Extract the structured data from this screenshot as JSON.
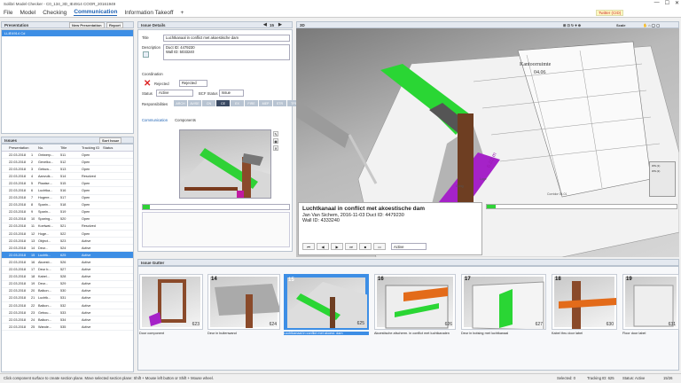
{
  "window": {
    "title": "Solibri Model Checker - C0_134_3D_IE4914 COOR_20161949",
    "minimize": "—",
    "maximize": "☐",
    "close": "✕"
  },
  "menu": {
    "items": [
      "File",
      "Model",
      "Checking",
      "Communication",
      "Information Takeoff",
      "+"
    ]
  },
  "toolbar_right": {
    "twitter": "Twitter (CID)"
  },
  "presentation": {
    "title": "Presentation",
    "new_btn": "New Presentation",
    "report_btn": "Report",
    "items": [
      "LLIE4914 Cd"
    ]
  },
  "issues": {
    "title": "Issues",
    "sort_btn": "Sort Issue",
    "columns": [
      "Presentation",
      "No.",
      "Title",
      "Tracking ID",
      "Status"
    ],
    "rows": [
      [
        "22.03.2018",
        "1",
        "Ontwerp...",
        "511",
        "Open"
      ],
      [
        "22.03.2018",
        "2",
        "Gevelko...",
        "512",
        "Open"
      ],
      [
        "22.03.2018",
        "3",
        "Gebuw...",
        "513",
        "Open"
      ],
      [
        "22.03.2018",
        "4",
        "Aanvulk...",
        "514",
        "Resolved"
      ],
      [
        "22.03.2018",
        "5",
        "Plaatse...",
        "515",
        "Open"
      ],
      [
        "22.03.2018",
        "6",
        "Luchtka...",
        "516",
        "Open"
      ],
      [
        "22.03.2018",
        "7",
        "Hogere...",
        "517",
        "Open"
      ],
      [
        "22.03.2018",
        "8",
        "Sparin...",
        "518",
        "Open"
      ],
      [
        "22.03.2018",
        "9",
        "Sparin...",
        "519",
        "Open"
      ],
      [
        "22.03.2018",
        "10",
        "Sparing...",
        "520",
        "Open"
      ],
      [
        "22.03.2018",
        "11",
        "Koelwat...",
        "521",
        "Resolved"
      ],
      [
        "22.03.2018",
        "12",
        "Hoge...",
        "522",
        "Open"
      ],
      [
        "22.03.2018",
        "13",
        "Object...",
        "523",
        "Active"
      ],
      [
        "22.03.2018",
        "14",
        "Deur...",
        "524",
        "Active"
      ],
      [
        "22.03.2018",
        "15",
        "Luchtk...",
        "625",
        "Active"
      ],
      [
        "22.03.2018",
        "16",
        "Akoesti...",
        "526",
        "Active"
      ],
      [
        "22.03.2018",
        "17",
        "Deur b...",
        "527",
        "Active"
      ],
      [
        "22.03.2018",
        "18",
        "Kabel...",
        "528",
        "Active"
      ],
      [
        "22.03.2018",
        "19",
        "Deur...",
        "529",
        "Active"
      ],
      [
        "22.03.2018",
        "20",
        "Balkon...",
        "530",
        "Active"
      ],
      [
        "22.03.2018",
        "21",
        "Luchtk...",
        "531",
        "Active"
      ],
      [
        "22.03.2018",
        "22",
        "Balkon...",
        "532",
        "Active"
      ],
      [
        "22.03.2018",
        "23",
        "Gebou...",
        "533",
        "Active"
      ],
      [
        "22.03.2018",
        "24",
        "Balkon...",
        "534",
        "Active"
      ],
      [
        "22.03.2018",
        "25",
        "Wande...",
        "535",
        "Active"
      ]
    ],
    "selected_index": 14
  },
  "issue_details": {
    "title": "Issue Details",
    "page": "15",
    "title_label": "Title",
    "title_value": "Luchtkanaal in conflict met akoestische dam",
    "desc_label": "Description",
    "desc_lines": [
      "Duct ID: 4479230",
      "Wall ID: 5033240"
    ],
    "coordination_label": "Coordination",
    "rejected_label": "Rejected",
    "rejected_value": "Rejected",
    "status_label": "Status",
    "status_value": "Active",
    "bcf_label": "BCF Status",
    "bcf_value": "Issue",
    "responsibilities_label": "Responsibilities",
    "responsibilities": [
      "ARCH",
      "AV/SE",
      "CN",
      "CE",
      "EX",
      "FIRE",
      "MEP",
      "STR",
      "TPE"
    ],
    "active_resp": "CE",
    "tabs": [
      "Communication",
      "Components"
    ]
  },
  "view3d": {
    "title": "3D",
    "zoom_label": "Scale",
    "plan_title": "Kantoorruimte",
    "plan_number": "04.06",
    "room_labels": [
      "Loge",
      "Gang",
      "Corridor 04.01"
    ],
    "dimension": "6.02 m",
    "issue_title": "Luchtkanaal in conflict met akoestische dam",
    "issue_meta": "Jan Van Sichem, 2016-11-03 Duct ID: 4479230",
    "issue_wall": "Wall ID: 4333240",
    "status_value": "Active",
    "callout_labels": [
      "WS (1)",
      "WS (2)"
    ]
  },
  "gutter": {
    "title": "Issue Gutter",
    "items": [
      {
        "num": "",
        "count": "623",
        "caption": "Door component"
      },
      {
        "num": "14",
        "count": "624",
        "caption": "Deur in buitenwand"
      },
      {
        "num": "15",
        "count": "625",
        "caption": "Luchtkanaal in conflict met akoest. dam"
      },
      {
        "num": "16",
        "count": "626",
        "caption": "Akoestische afscherm. in conflict met luchtkanalen"
      },
      {
        "num": "17",
        "count": "627",
        "caption": "Deur in botsing met luchtkanaal"
      },
      {
        "num": "18",
        "count": "630",
        "caption": "Kabel thru door label"
      },
      {
        "num": "19",
        "count": "631",
        "caption": "Floor door label"
      }
    ],
    "selected_index": 2
  },
  "statusbar": {
    "hint": "Click component surface to create section plane. Move selected section plane: Shift + Mouse left button or Shift + Mouse wheel.",
    "selected": "Selected: 0",
    "tracking": "Tracking ID: 625",
    "status": "Status: Active",
    "count": "15/26"
  },
  "colors": {
    "accent": "#3d8ee5",
    "active_tab": "#1e62b4",
    "duct": "#1ed12a",
    "purple": "#a522c8"
  }
}
